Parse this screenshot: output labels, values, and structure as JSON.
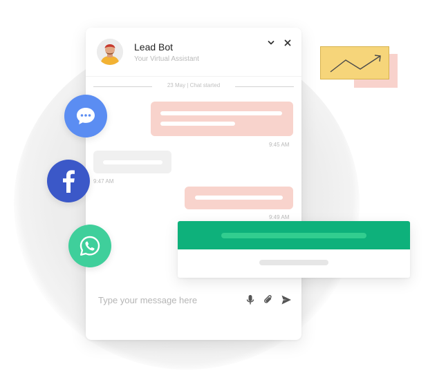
{
  "chat": {
    "bot_name": "Lead Bot",
    "bot_subtitle": "Your Virtual Assistant",
    "date_label": "23 May | Chat started",
    "composer_placeholder": "Type your message here",
    "messages": [
      {
        "direction": "outgoing",
        "time": "9:45 AM"
      },
      {
        "direction": "incoming",
        "time": "9:47 AM"
      },
      {
        "direction": "outgoing",
        "time": "9:49 AM"
      }
    ]
  },
  "icons": {
    "minimize": "chevron-down-icon",
    "close": "close-icon",
    "mic": "microphone-icon",
    "attach": "paperclip-icon",
    "send": "send-icon",
    "messenger": "chat-bubble-icon",
    "facebook": "facebook-icon",
    "whatsapp": "whatsapp-icon",
    "trend": "trend-up-icon"
  },
  "colors": {
    "outgoing_bubble": "#f8d3cc",
    "incoming_bubble": "#f0f0f0",
    "cta_green": "#0eb17b",
    "messenger_blue": "#5b8df2",
    "facebook_blue": "#3b58c8",
    "whatsapp_green": "#3fcf9b",
    "chart_card_yellow": "#f6d57a"
  }
}
